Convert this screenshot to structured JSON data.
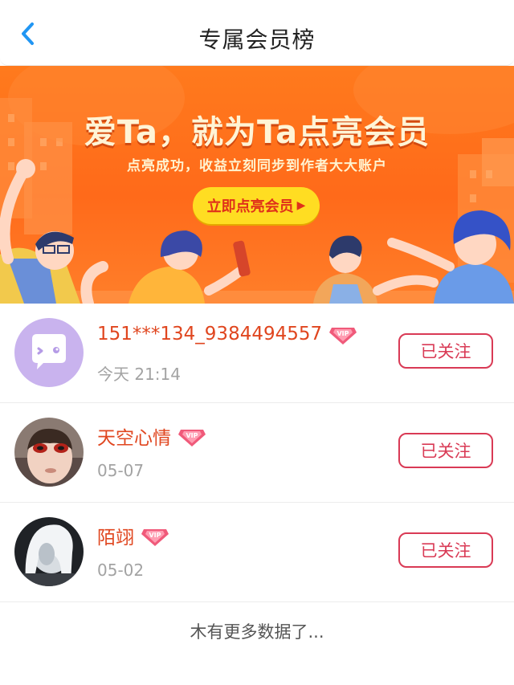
{
  "header": {
    "title": "专属会员榜"
  },
  "banner": {
    "headline": "爱Ta，就为Ta点亮会员",
    "subtitle": "点亮成功，收益立刻同步到作者大大账户",
    "cta_label": "立即点亮会员"
  },
  "members": [
    {
      "name": "151***134_9384494557",
      "time": "今天 21:14",
      "follow_label": "已关注",
      "avatar_icon": "default-chat-avatar",
      "badge_text": "VIP"
    },
    {
      "name": "天空心情",
      "time": "05-07",
      "follow_label": "已关注",
      "avatar_icon": "child-photo-avatar",
      "badge_text": "VIP"
    },
    {
      "name": "陌翊",
      "time": "05-02",
      "follow_label": "已关注",
      "avatar_icon": "character-photo-avatar",
      "badge_text": "VIP"
    }
  ],
  "footer": {
    "text": "木有更多数据了..."
  },
  "colors": {
    "accent_blue": "#2196f3",
    "banner_orange": "#ff6a1a",
    "cta_yellow": "#ffdd22",
    "name_red": "#e0461f",
    "follow_border": "#d93a55",
    "vip_pink": "#f05a7a"
  }
}
